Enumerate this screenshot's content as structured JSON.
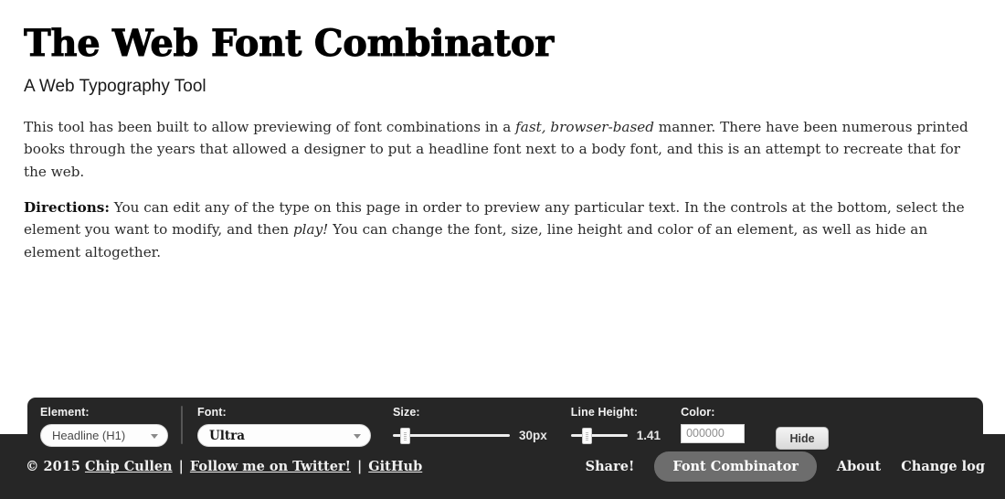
{
  "page": {
    "title": "The Web Font Combinator",
    "subtitle": "A Web Typography Tool",
    "intro_part1": "This tool has been built to allow previewing of font combinations in a ",
    "intro_em1": "fast, browser-based",
    "intro_part2": " manner. There have been numerous printed books through the years that allowed a designer to put a headline font next to a body font, and this is an attempt to recreate that for the web.",
    "directions_label": "Directions:",
    "directions_part1": " You can edit any of the type on this page in order to preview any particular text. In the controls at the bottom, select the element you want to modify, and then ",
    "directions_em": "play!",
    "directions_part2": " You can change the font, size, line height and color of an element, as well as hide an element altogether."
  },
  "controls": {
    "element": {
      "label": "Element:",
      "value": "Headline (H1)",
      "caret_icon": "chevron-down-icon"
    },
    "font": {
      "label": "Font:",
      "value": "Ultra",
      "caret_icon": "chevron-down-icon"
    },
    "size": {
      "label": "Size:",
      "value": "30px",
      "slider_percent": 10
    },
    "line_height": {
      "label": "Line Height:",
      "value": "1.41",
      "slider_percent": 28
    },
    "color": {
      "label": "Color:",
      "value": "000000",
      "placeholder": "000000"
    },
    "hide_button": "Hide"
  },
  "footer": {
    "copyright_prefix": "© 2015 ",
    "author_link": "Chip Cullen",
    "twitter_link": "Follow me on Twitter!",
    "github_link": "GitHub",
    "separator": "|",
    "nav": [
      {
        "label": "Share!",
        "active": false
      },
      {
        "label": "Font Combinator",
        "active": true
      },
      {
        "label": "About",
        "active": false
      },
      {
        "label": "Change log",
        "active": false
      }
    ]
  },
  "colors": {
    "footer_bg": "#262626",
    "active_pill": "#6d6d6d",
    "text": "#2a2a2a"
  }
}
